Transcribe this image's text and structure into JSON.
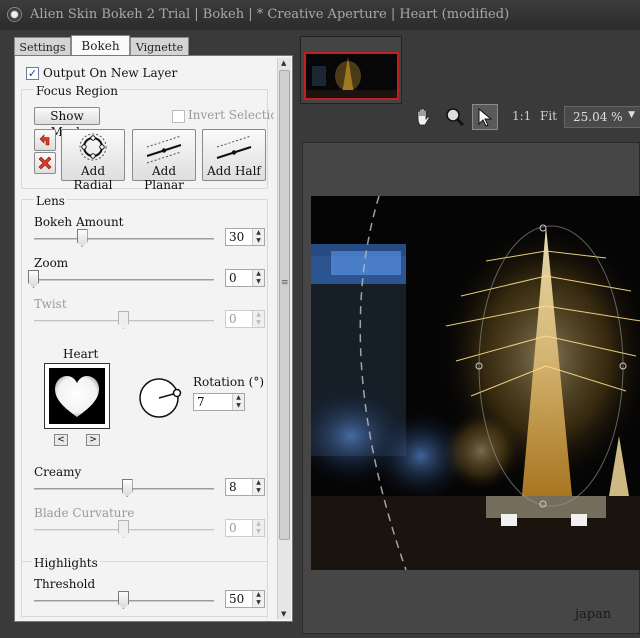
{
  "window": {
    "title": "Alien Skin Bokeh 2 Trial | Bokeh | * Creative Aperture | Heart (modified)"
  },
  "tabs": [
    {
      "label": "Settings",
      "active": false
    },
    {
      "label": "Bokeh",
      "active": true
    },
    {
      "label": "Vignette",
      "active": false
    }
  ],
  "output_layer": {
    "label": "Output On New Layer",
    "checked": true
  },
  "focus_region": {
    "heading": "Focus Region",
    "show_mask_label": "Show Mask",
    "invert_selection": {
      "label": "Invert Selection",
      "checked": false,
      "enabled": false
    },
    "buttons": [
      {
        "label": "Add Radial",
        "icon": "radial-icon"
      },
      {
        "label": "Add Planar",
        "icon": "planar-icon"
      },
      {
        "label": "Add Half",
        "icon": "half-icon"
      }
    ]
  },
  "lens": {
    "heading": "Lens",
    "bokeh_amount": {
      "label": "Bokeh Amount",
      "value": "30",
      "fraction": 0.27
    },
    "zoom": {
      "label": "Zoom",
      "value": "0",
      "fraction": 0.0
    },
    "twist": {
      "label": "Twist",
      "value": "0",
      "fraction": 0.5,
      "enabled": false
    },
    "shape": {
      "label": "Heart",
      "prev": "<",
      "next": ">"
    },
    "rotation": {
      "label": "Rotation (°)",
      "value": "7"
    },
    "creamy": {
      "label": "Creamy",
      "value": "8",
      "fraction": 0.52
    },
    "blade_curvature": {
      "label": "Blade Curvature",
      "value": "0",
      "fraction": 0.5,
      "enabled": false
    }
  },
  "highlights": {
    "heading": "Highlights",
    "threshold": {
      "label": "Threshold",
      "value": "50",
      "fraction": 0.5
    }
  },
  "toolbar": {
    "zoom_1to1": "1:1",
    "fit": "Fit",
    "zoom_value": "25.04 %"
  },
  "preview": {
    "caption": "japan"
  },
  "colors": {
    "accent_red": "#c02020",
    "panel_bg": "#f3f3f3",
    "app_bg": "#3a3a3a"
  }
}
